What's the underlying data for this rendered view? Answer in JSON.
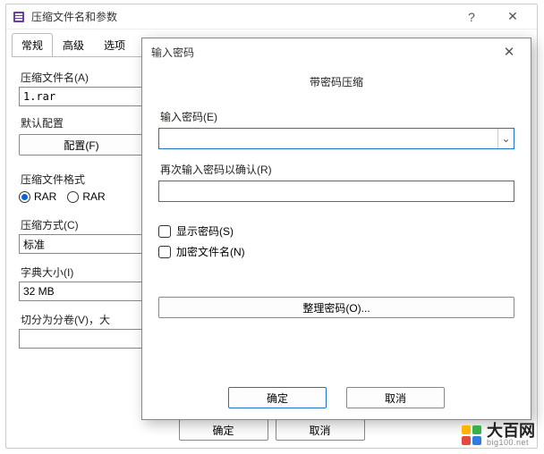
{
  "mainWindow": {
    "title": "压缩文件名和参数",
    "helpGlyph": "?",
    "closeGlyph": "✕",
    "tabs": [
      "常规",
      "高级",
      "选项"
    ],
    "archiveNameLabel": "压缩文件名(A)",
    "archiveNameValue": "1.rar",
    "defaultProfileLabel": "默认配置",
    "profilesBtn": "配置(F)",
    "formatLabel": "压缩文件格式",
    "formatRar": "RAR",
    "formatRar5": "RAR",
    "methodLabel": "压缩方式(C)",
    "methodValue": "标准",
    "dictLabel": "字典大小(I)",
    "dictValue": "32 MB",
    "splitLabel": "切分为分卷(V)，大",
    "okBtn": "确定",
    "cancelBtn": "取消"
  },
  "modal": {
    "title": "输入密码",
    "closeGlyph": "✕",
    "header": "带密码压缩",
    "enterPwdLabel": "输入密码(E)",
    "reenterPwdLabel": "再次输入密码以确认(R)",
    "showPwdLabel": "显示密码(S)",
    "encryptNamesLabel": "加密文件名(N)",
    "organizeBtn": "整理密码(O)...",
    "okBtn": "确定",
    "cancelBtn": "取消",
    "ddGlyph": "⌄"
  },
  "watermark": {
    "big": "大百网",
    "small": "big100.net"
  }
}
